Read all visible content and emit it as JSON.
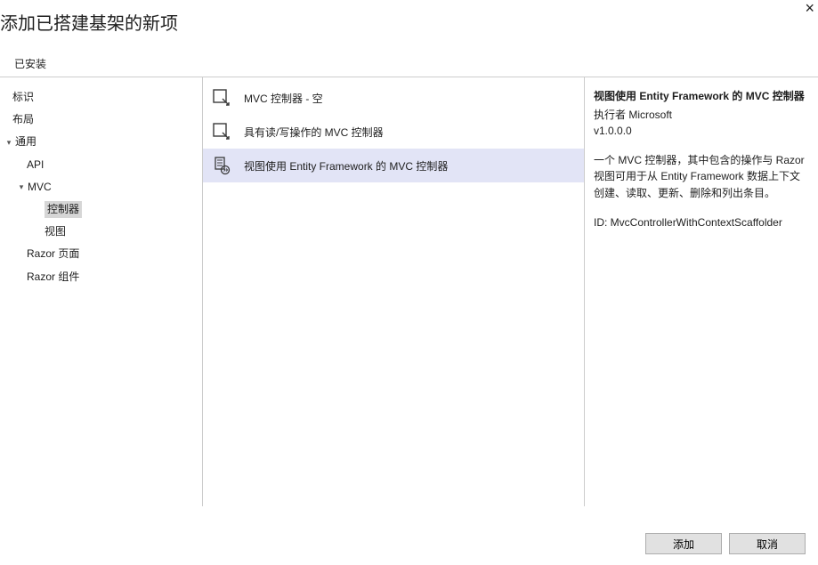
{
  "dialog": {
    "title": "添加已搭建基架的新项",
    "close": "×"
  },
  "tabs": {
    "installed": "已安装"
  },
  "tree": {
    "items": [
      {
        "label": "标识",
        "indent": 0,
        "arrow": false,
        "selected": false
      },
      {
        "label": "布局",
        "indent": 0,
        "arrow": false,
        "selected": false
      },
      {
        "label": "通用",
        "indent": 0,
        "arrow": true,
        "selected": false
      },
      {
        "label": "API",
        "indent": 1,
        "arrow": false,
        "selected": false
      },
      {
        "label": "MVC",
        "indent": 1,
        "arrow": true,
        "selected": false
      },
      {
        "label": "控制器",
        "indent": 2,
        "arrow": false,
        "selected": true
      },
      {
        "label": "视图",
        "indent": 2,
        "arrow": false,
        "selected": false
      },
      {
        "label": "Razor 页面",
        "indent": 1,
        "arrow": false,
        "selected": false
      },
      {
        "label": "Razor 组件",
        "indent": 1,
        "arrow": false,
        "selected": false
      }
    ]
  },
  "templates": {
    "items": [
      {
        "label": "MVC 控制器 - 空",
        "selected": false
      },
      {
        "label": "具有读/写操作的 MVC 控制器",
        "selected": false
      },
      {
        "label": "视图使用 Entity Framework 的 MVC 控制器",
        "selected": true
      }
    ]
  },
  "details": {
    "title": "视图使用 Entity Framework 的 MVC 控制器",
    "author": "执行者 Microsoft",
    "version": "v1.0.0.0",
    "description": "一个 MVC 控制器，其中包含的操作与 Razor 视图可用于从 Entity Framework 数据上下文创建、读取、更新、删除和列出条目。",
    "id_label": "ID: MvcControllerWithContextScaffolder"
  },
  "footer": {
    "add": "添加",
    "cancel": "取消"
  }
}
